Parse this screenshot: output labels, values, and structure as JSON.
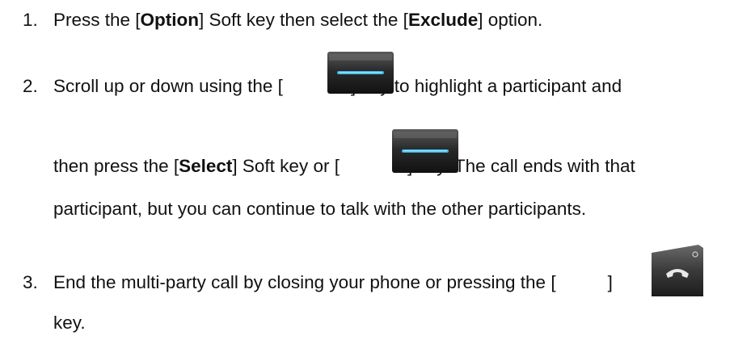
{
  "steps": [
    {
      "number": "1.",
      "line1": {
        "t1": "Press the [",
        "b1": "Option",
        "t2": "] Soft key then select the [",
        "b2": "Exclude",
        "t3": "] option."
      }
    },
    {
      "number": "2.",
      "line1": {
        "t1": "Scroll up or down using the [",
        "t2": "] key to highlight a participant and"
      },
      "line2": {
        "t1": "then press the [",
        "b1": "Select",
        "t2": "] Soft key or [",
        "t3": "] key. The call ends with that"
      },
      "line3": "participant, but you can continue to talk with the other participants."
    },
    {
      "number": "3.",
      "line1": {
        "t1": "End the multi-party call by closing your phone or pressing the [",
        "t2": "]"
      },
      "line2": "key."
    }
  ],
  "icons": {
    "nav_key": "navigation-ok-key-icon",
    "end_key": "end-call-key-icon"
  },
  "colors": {
    "text": "#111111",
    "key_body": "#2b2b2b",
    "key_highlight": "#3ab8e8"
  }
}
